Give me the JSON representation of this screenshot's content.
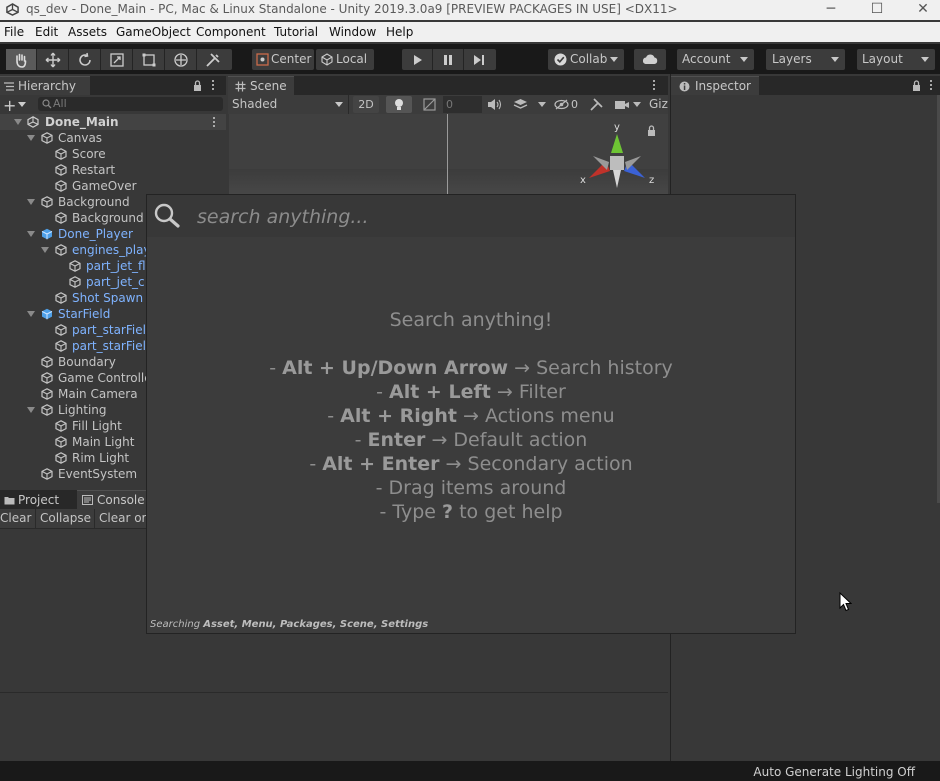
{
  "window": {
    "title": "qs_dev - Done_Main - PC, Mac & Linux Standalone - Unity 2019.3.0a9 [PREVIEW PACKAGES IN USE] <DX11>",
    "minimize_glyph": "─",
    "maximize_glyph": "☐",
    "close_glyph": "✕"
  },
  "menu": [
    "File",
    "Edit",
    "Assets",
    "GameObject",
    "Component",
    "Tutorial",
    "Window",
    "Help"
  ],
  "toolbar": {
    "pivot_label": "Center",
    "space_label": "Local",
    "collab_label": "Collab",
    "account_label": "Account",
    "layers_label": "Layers",
    "layout_label": "Layout"
  },
  "hierarchy": {
    "tab_label": "Hierarchy",
    "search_placeholder": "All",
    "scene_name": "Done_Main",
    "items": [
      {
        "label": "Canvas",
        "depth": 1,
        "foldout": true,
        "blue": false
      },
      {
        "label": "Score",
        "depth": 2,
        "foldout": false,
        "blue": false
      },
      {
        "label": "Restart",
        "depth": 2,
        "foldout": false,
        "blue": false
      },
      {
        "label": "GameOver",
        "depth": 2,
        "foldout": false,
        "blue": false
      },
      {
        "label": "Background",
        "depth": 1,
        "foldout": true,
        "blue": false
      },
      {
        "label": "Background",
        "depth": 2,
        "foldout": false,
        "blue": false
      },
      {
        "label": "Done_Player",
        "depth": 1,
        "foldout": true,
        "blue": true
      },
      {
        "label": "engines_play",
        "depth": 2,
        "foldout": true,
        "blue": true
      },
      {
        "label": "part_jet_fl",
        "depth": 3,
        "foldout": false,
        "blue": true
      },
      {
        "label": "part_jet_c",
        "depth": 3,
        "foldout": false,
        "blue": true
      },
      {
        "label": "Shot Spawn",
        "depth": 2,
        "foldout": false,
        "blue": true
      },
      {
        "label": "StarField",
        "depth": 1,
        "foldout": true,
        "blue": true
      },
      {
        "label": "part_starFiel",
        "depth": 2,
        "foldout": false,
        "blue": true
      },
      {
        "label": "part_starFiel",
        "depth": 2,
        "foldout": false,
        "blue": true
      },
      {
        "label": "Boundary",
        "depth": 1,
        "foldout": false,
        "blue": false
      },
      {
        "label": "Game Controlle",
        "depth": 1,
        "foldout": false,
        "blue": false
      },
      {
        "label": "Main Camera",
        "depth": 1,
        "foldout": false,
        "blue": false
      },
      {
        "label": "Lighting",
        "depth": 1,
        "foldout": true,
        "blue": false
      },
      {
        "label": "Fill Light",
        "depth": 2,
        "foldout": false,
        "blue": false
      },
      {
        "label": "Main Light",
        "depth": 2,
        "foldout": false,
        "blue": false
      },
      {
        "label": "Rim Light",
        "depth": 2,
        "foldout": false,
        "blue": false
      },
      {
        "label": "EventSystem",
        "depth": 1,
        "foldout": false,
        "blue": false
      }
    ]
  },
  "bottom_panel": {
    "tabs": [
      "Project",
      "Console"
    ],
    "buttons": [
      "Clear",
      "Collapse",
      "Clear or"
    ]
  },
  "scene": {
    "tab_label": "Scene",
    "shading_mode": "Shaded",
    "mode_2d": "2D",
    "audio_value": "0",
    "hidden_count": "0",
    "gizmos_label": "Giz",
    "gizmo_axes": {
      "x": "x",
      "y": "y",
      "z": "z"
    }
  },
  "inspector": {
    "tab_label": "Inspector"
  },
  "search_overlay": {
    "placeholder": "search anything...",
    "heading": "Search anything!",
    "help": [
      {
        "prefix": "- ",
        "key": "Alt + Up/Down Arrow",
        "arrow": " → ",
        "action": "Search history"
      },
      {
        "prefix": "- ",
        "key": "Alt + Left",
        "arrow": " → ",
        "action": "Filter"
      },
      {
        "prefix": "- ",
        "key": "Alt + Right",
        "arrow": " → ",
        "action": "Actions menu"
      },
      {
        "prefix": "- ",
        "key": "Enter",
        "arrow": " → ",
        "action": "Default action"
      },
      {
        "prefix": "- ",
        "key": "Alt + Enter",
        "arrow": " → ",
        "action": "Secondary action"
      },
      {
        "prefix": "- ",
        "key": "",
        "arrow": "",
        "action": "Drag items around"
      },
      {
        "prefix": "- Type ",
        "key": "?",
        "arrow": " ",
        "action": "to get help"
      }
    ],
    "footer_prefix": "Searching ",
    "footer_providers": "Asset, Menu, Packages, Scene, Settings"
  },
  "status_bar": {
    "lighting_status": "Auto Generate Lighting Off"
  },
  "colors": {
    "selected_blue": "#7fb3ff",
    "panel_bg": "#383838",
    "toolbar_bg": "#191919"
  }
}
